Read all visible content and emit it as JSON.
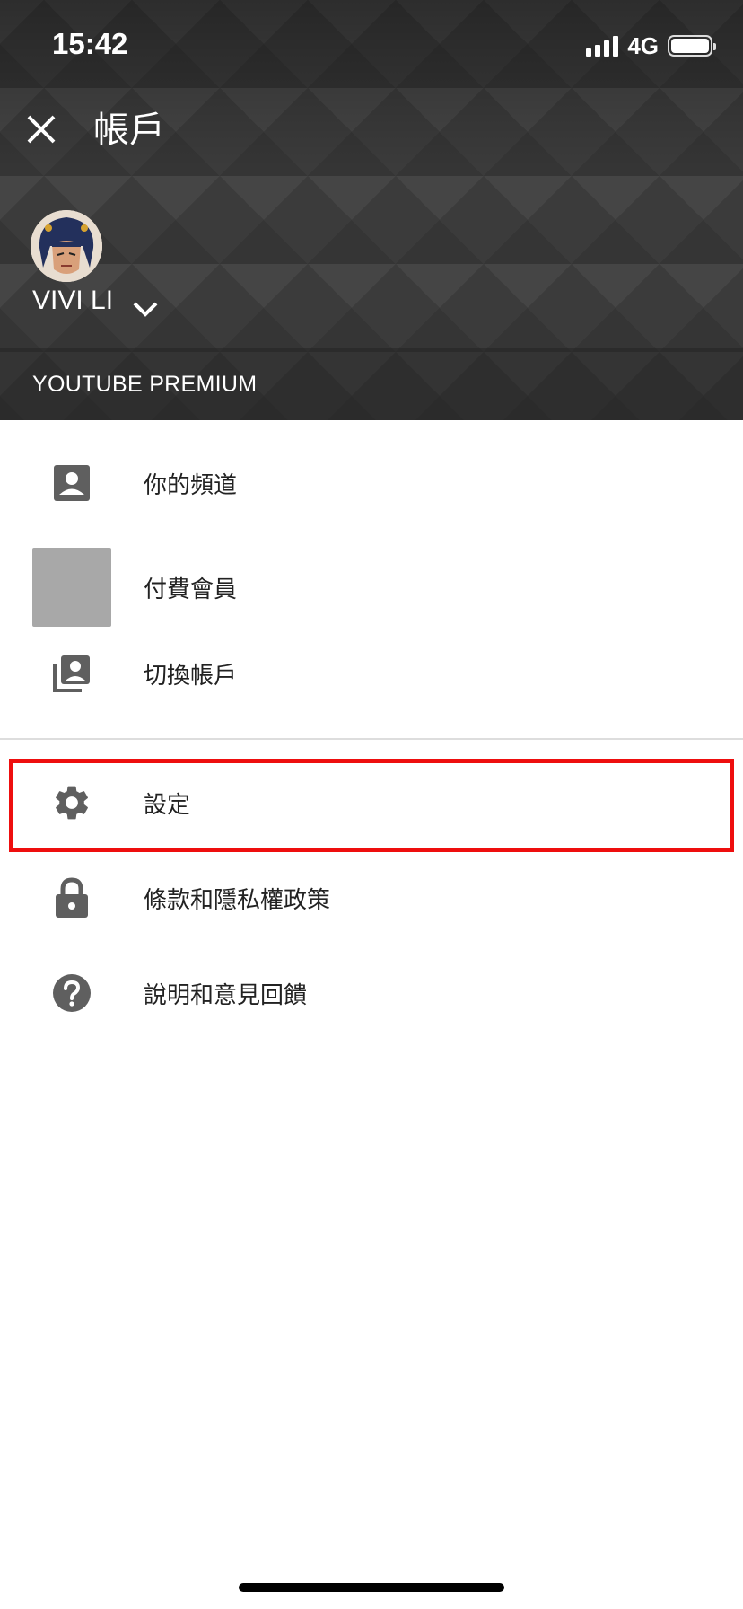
{
  "status_bar": {
    "time": "15:42",
    "network": "4G"
  },
  "header": {
    "title": "帳戶",
    "account_name": "VIVI LI",
    "premium_label": "YOUTUBE PREMIUM"
  },
  "menu": {
    "your_channel": "你的頻道",
    "paid_membership": "付費會員",
    "switch_account": "切換帳戶",
    "settings": "設定",
    "terms_privacy": "條款和隱私權政策",
    "help_feedback": "說明和意見回饋"
  },
  "colors": {
    "header_bg": "#3b3b3b",
    "highlight_border": "#ee0e0e",
    "icon": "#5f5f5f"
  },
  "icons": [
    "close-icon",
    "chevron-down-icon",
    "account-box-icon",
    "switch-account-icon",
    "gear-icon",
    "lock-icon",
    "help-icon"
  ]
}
